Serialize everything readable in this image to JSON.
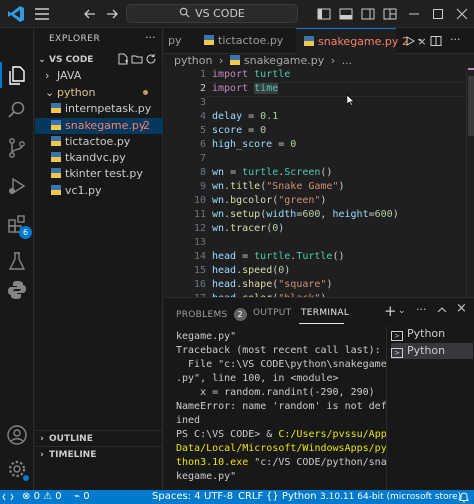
{
  "window": {
    "search_text": "VS CODE"
  },
  "activity": {
    "extensions_badge": "6"
  },
  "sidebar": {
    "header": "EXPLORER",
    "root_label": "VS CODE",
    "items": [
      {
        "label": "JAVA",
        "kind": "folder-collapsed"
      },
      {
        "label": "python",
        "kind": "folder-open"
      },
      {
        "label": "internpetask.py",
        "kind": "file"
      },
      {
        "label": "snakegame.py",
        "kind": "file",
        "badge": "2"
      },
      {
        "label": "tictactoe.py",
        "kind": "file"
      },
      {
        "label": "tkandvc.py",
        "kind": "file"
      },
      {
        "label": "tkinter test.py",
        "kind": "file"
      },
      {
        "label": "vc1.py",
        "kind": "file"
      }
    ],
    "outline_label": "OUTLINE",
    "timeline_label": "TIMELINE"
  },
  "tabs": [
    {
      "label": "py",
      "active": false
    },
    {
      "label": "tictactoe.py",
      "active": false
    },
    {
      "label": "snakegame.py 2",
      "active": true
    }
  ],
  "breadcrumb": [
    "python",
    "snakegame.py"
  ],
  "editor": {
    "line_numbers": [
      "1",
      "2",
      "3",
      "4",
      "5",
      "6",
      "7",
      "8",
      "9",
      "10",
      "11",
      "12",
      "13",
      "14",
      "15",
      "16",
      "17"
    ],
    "current_line": 2
  },
  "panel": {
    "tabs": [
      {
        "label": "PROBLEMS",
        "badge": "2"
      },
      {
        "label": "OUTPUT"
      },
      {
        "label": "TERMINAL",
        "active": true
      }
    ],
    "terminal_lines": [
      "kegame.py\"",
      "Traceback (most recent call last):",
      "  File \"c:\\VS CODE\\python\\snakegame",
      ".py\", line 100, in <module>",
      "    x = random.randint(-290, 290)",
      "NameError: name 'random' is not def",
      "ined",
      "PS C:\\VS CODE> & ",
      "C:/Users/pvssu/App",
      "Data/Local/Microsoft/WindowsApps/py",
      "thon3.10.exe",
      " \"c:/VS CODE/python/sna",
      "kegame.py\""
    ],
    "terminals": [
      "Python",
      "Python"
    ]
  },
  "statusbar": {
    "errors": "0",
    "warnings": "0",
    "ports": "0",
    "spaces": "Spaces: 4",
    "encoding": "UTF-8",
    "eol": "CRLF",
    "language": "Python",
    "interpreter": "3.10.11 64-bit (microsoft store)"
  },
  "colors": {
    "accent": "#0078d4",
    "statusbar": "#007acc"
  }
}
